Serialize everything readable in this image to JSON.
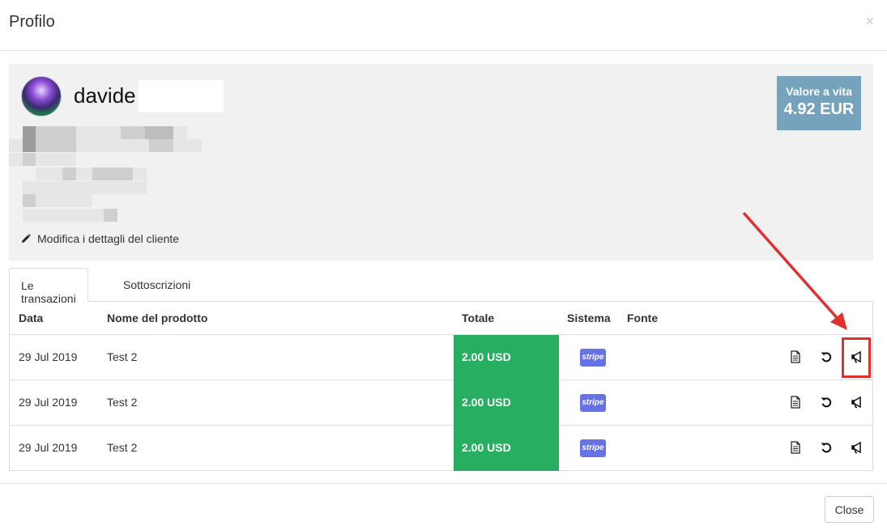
{
  "modal": {
    "title": "Profilo",
    "close_symbol": "×"
  },
  "customer": {
    "name": "davide",
    "edit_label": "Modifica i dettagli del cliente",
    "lifetime_value": {
      "label": "Valore a vita",
      "value": "4.92 EUR"
    }
  },
  "tabs": [
    {
      "label": "Le transazioni",
      "active": true
    },
    {
      "label": "Sottoscrizioni",
      "active": false
    }
  ],
  "table": {
    "headers": {
      "date": "Data",
      "product": "Nome del prodotto",
      "total": "Totale",
      "system": "Sistema",
      "source": "Fonte"
    },
    "rows": [
      {
        "date": "29 Jul 2019",
        "product": "Test 2",
        "total": "2.00 USD",
        "system": "stripe"
      },
      {
        "date": "29 Jul 2019",
        "product": "Test 2",
        "total": "2.00 USD",
        "system": "stripe"
      },
      {
        "date": "29 Jul 2019",
        "product": "Test 2",
        "total": "2.00 USD",
        "system": "stripe"
      }
    ],
    "row_actions": [
      "document-icon",
      "refund-icon",
      "megaphone-icon"
    ]
  },
  "footer": {
    "close_label": "Close"
  },
  "colors": {
    "total_bg": "#27ae60",
    "stripe": "#6772e5",
    "ltv_badge": "#75a3be",
    "annotation": "#e03030"
  }
}
